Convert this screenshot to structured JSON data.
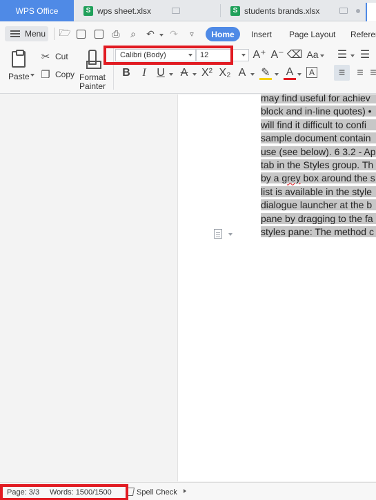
{
  "tabs": {
    "app": "WPS Office",
    "doc1": "wps sheet.xlsx",
    "doc2": "students brands.xlsx",
    "sheet_glyph": "S"
  },
  "ribbon": {
    "menu_label": "Menu",
    "tabs": [
      "Home",
      "Insert",
      "Page Layout",
      "Referer"
    ],
    "active_tab": "Home",
    "paste_label": "Paste",
    "cut_label": "Cut",
    "copy_label": "Copy",
    "format_painter_label": [
      "Format",
      "Painter"
    ],
    "font_name": "Calibri (Body)",
    "font_size": "12"
  },
  "document": {
    "lines": [
      "may find useful for achiev",
      "block and in-line quotes) •",
      "will find it difficult to confi",
      "sample document contain",
      "use (see below). 6 3.2 - Ap",
      "tab in the Styles group. Th",
      "by a grey box around the s",
      "list is available in the style",
      "dialogue launcher at the b",
      "pane by dragging to the fa",
      "styles pane: The method c"
    ]
  },
  "status": {
    "page": "Page: 3/3",
    "words": "Words: 1500/1500",
    "spell_check": "Spell Check"
  },
  "colors": {
    "accent": "#4f8ae6",
    "highlight_box": "#e11b22",
    "text_highlight": "#c7c7c7"
  }
}
